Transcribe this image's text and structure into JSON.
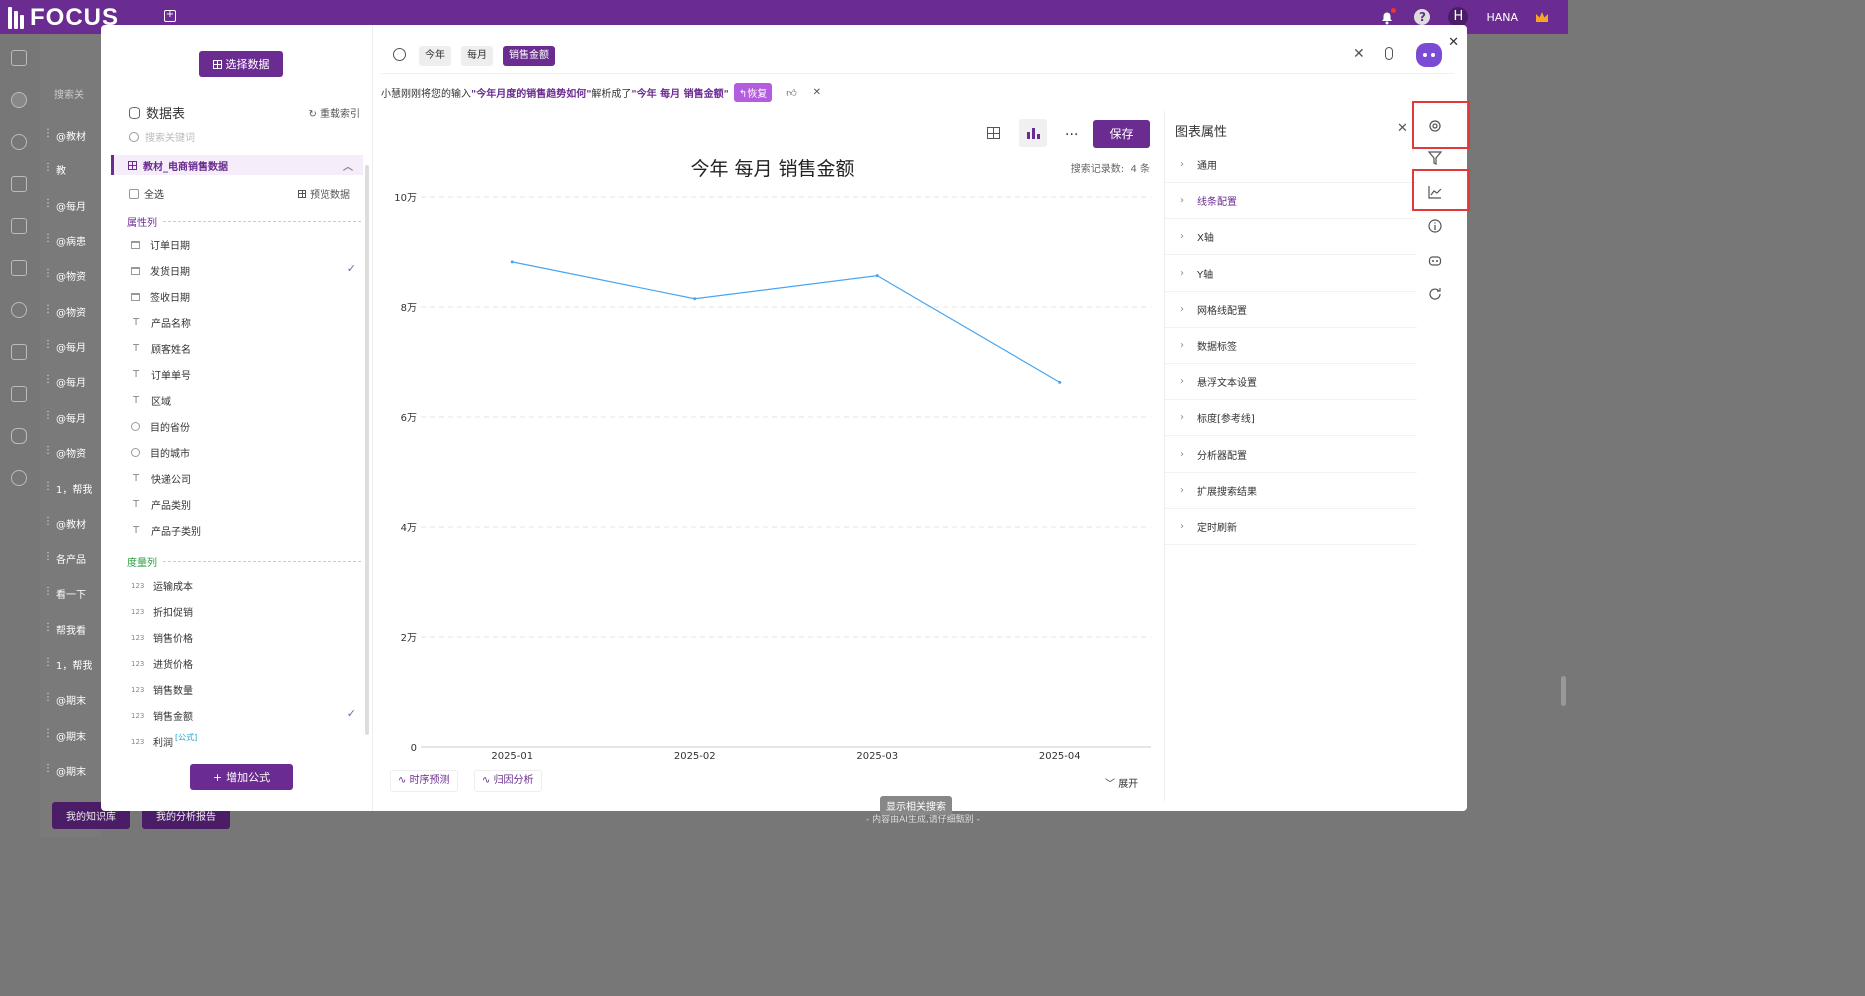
{
  "app": {
    "logo_text": "FOCUS",
    "user_initial": "H",
    "user_name": "HANA"
  },
  "background": {
    "search_placeholder": "搜索关",
    "list_items": [
      "@教材",
      "教",
      "@每月",
      "@病患",
      "@物资",
      "@物资",
      "@每月",
      "@每月",
      "@每月",
      "@物资",
      "1，帮我",
      "@教材",
      "各产品",
      "看一下",
      "帮我看",
      "1，帮我",
      "@期末",
      "@期末",
      "@期末"
    ],
    "btn_knowledge": "我的知识库",
    "btn_report": "我的分析报告",
    "footer": "- 内容由AI生成,请仔细甄别 -",
    "related_search": "显示相关搜索"
  },
  "data_panel": {
    "select_data_label": "选择数据",
    "datatable_title": "数据表",
    "reindex_label": "重载索引",
    "search_placeholder": "搜索关键词",
    "table_name": "教材_电商销售数据",
    "select_all": "全选",
    "preview": "预览数据",
    "attr_section": "属性列",
    "measure_section": "度量列",
    "attributes": [
      {
        "name": "订单日期",
        "icon": "calendar-icon",
        "checked": false
      },
      {
        "name": "发货日期",
        "icon": "calendar-icon",
        "checked": true
      },
      {
        "name": "签收日期",
        "icon": "calendar-icon",
        "checked": false
      },
      {
        "name": "产品名称",
        "icon": "text-icon",
        "checked": false
      },
      {
        "name": "顾客姓名",
        "icon": "text-icon",
        "checked": false
      },
      {
        "name": "订单单号",
        "icon": "text-icon",
        "checked": false
      },
      {
        "name": "区域",
        "icon": "text-icon",
        "checked": false
      },
      {
        "name": "目的省份",
        "icon": "globe-icon",
        "checked": false
      },
      {
        "name": "目的城市",
        "icon": "globe-icon",
        "checked": false
      },
      {
        "name": "快递公司",
        "icon": "text-icon",
        "checked": false
      },
      {
        "name": "产品类别",
        "icon": "text-icon",
        "checked": false
      },
      {
        "name": "产品子类别",
        "icon": "text-icon",
        "checked": false
      }
    ],
    "measures": [
      {
        "name": "运输成本",
        "checked": false
      },
      {
        "name": "折扣促销",
        "checked": false
      },
      {
        "name": "销售价格",
        "checked": false
      },
      {
        "name": "进货价格",
        "checked": false
      },
      {
        "name": "销售数量",
        "checked": false
      },
      {
        "name": "销售金额",
        "checked": true
      },
      {
        "name": "利润",
        "checked": false,
        "tag": "[公式]"
      }
    ],
    "measure_icon_text": "123",
    "add_formula_label": "增加公式"
  },
  "search": {
    "chips": [
      "今年",
      "每月",
      "销售金额"
    ],
    "selected_chip": "销售金额"
  },
  "hint": {
    "prefix": "小慧刚刚将您的输入 ",
    "query": "\"今年月度的销售趋势如何\"",
    "middle": " 解析成了 ",
    "parsed": "\"今年 每月 销售金额\"",
    "restore_label": "恢复"
  },
  "chart_toolbar": {
    "more_label": "...",
    "save_label": "保存"
  },
  "chart_data": {
    "type": "line",
    "title": "今年 每月 销售金额",
    "record_count_label": "搜索记录数:",
    "record_count": "4 条",
    "categories": [
      "2025-01",
      "2025-02",
      "2025-03",
      "2025-04"
    ],
    "series": [
      {
        "values": [
          88200,
          81500,
          85700,
          66300
        ],
        "color": "#4aa5ef"
      }
    ],
    "ylim": [
      0,
      100000
    ],
    "yticks": [
      0,
      20000,
      40000,
      60000,
      80000,
      100000
    ],
    "ytick_labels": [
      "0",
      "2万",
      "4万",
      "6万",
      "8万",
      "10万"
    ],
    "grid": true
  },
  "chart_bottom": {
    "forecast_label": "时序预测",
    "cause_label": "归因分析",
    "expand_label": "展开"
  },
  "properties": {
    "title": "图表属性",
    "items": [
      "通用",
      "线条配置",
      "X轴",
      "Y轴",
      "网格线配置",
      "数据标签",
      "悬浮文本设置",
      "标度[参考线]",
      "分析器配置",
      "扩展搜索结果",
      "定时刷新"
    ],
    "active_item": "线条配置"
  },
  "colors": {
    "brand": "#6b2c91",
    "line": "#4aa5ef",
    "highlight_box": "#e23a3a",
    "measure_section": "#2aa140"
  }
}
